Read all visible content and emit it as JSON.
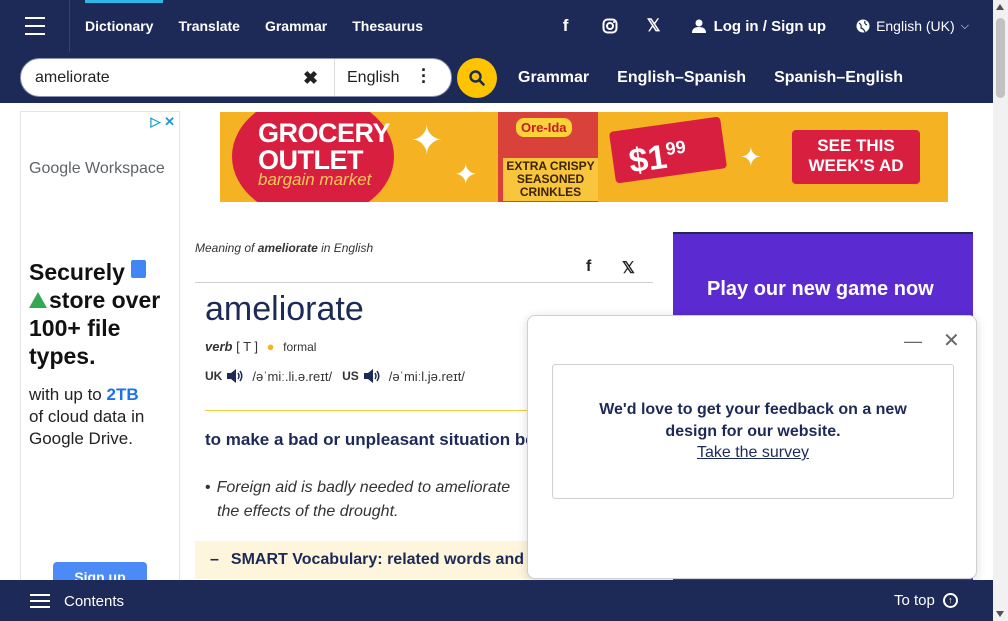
{
  "nav": {
    "items": [
      {
        "label": "Dictionary"
      },
      {
        "label": "Translate"
      },
      {
        "label": "Grammar"
      },
      {
        "label": "Thesaurus"
      }
    ],
    "social": [
      "f",
      "",
      "𝕏"
    ],
    "login": "Log in / Sign up",
    "language": "English (UK)"
  },
  "search": {
    "value": "ameliorate",
    "dictionary": "English",
    "quick_links": [
      "Grammar",
      "English–Spanish",
      "Spanish–English"
    ]
  },
  "left_ad": {
    "brand": "Google Workspace",
    "headline_1": "Securely",
    "headline_2": "store over 100+ file types.",
    "body_1": "with up to ",
    "body_hl": "2TB",
    "body_2": "of cloud data in Google Drive.",
    "button": "Sign up"
  },
  "banner": {
    "title": "GROCERY OUTLET",
    "subtitle": "bargain market",
    "product_brand": "Ore-Ida",
    "product_name": "EXTRA CRISPY SEASONED CRINKLES",
    "price": "$1",
    "price_cents": "99",
    "cta": "SEE THIS WEEK'S AD"
  },
  "entry": {
    "meaning_prefix": "Meaning of ",
    "meaning_word": "ameliorate",
    "meaning_suffix": " in English",
    "headword": "ameliorate",
    "pos": "verb",
    "grammar": "[ T ]",
    "register": "formal",
    "uk_label": "UK",
    "uk_ipa": "/əˈmiː.li.ə.reɪt/",
    "us_label": "US",
    "us_ipa": "/əˈmiːl.jə.reɪt/",
    "definition": "to make a bad or unpleasant situation better",
    "example": "Foreign aid is badly needed to ameliorate the effects of the drought.",
    "smart_vocab": "SMART Vocabulary: related words and phrases"
  },
  "right_ad": {
    "text": "Play our new game now"
  },
  "popup": {
    "message": "We'd love to get your feedback on a new design for our website.",
    "link": "Take the survey"
  },
  "bottom": {
    "contents": "Contents",
    "to_top": "To top"
  },
  "colors": {
    "navy": "#1d2a57",
    "accent_yellow": "#fec400",
    "active_tab": "#2fb8e6"
  }
}
